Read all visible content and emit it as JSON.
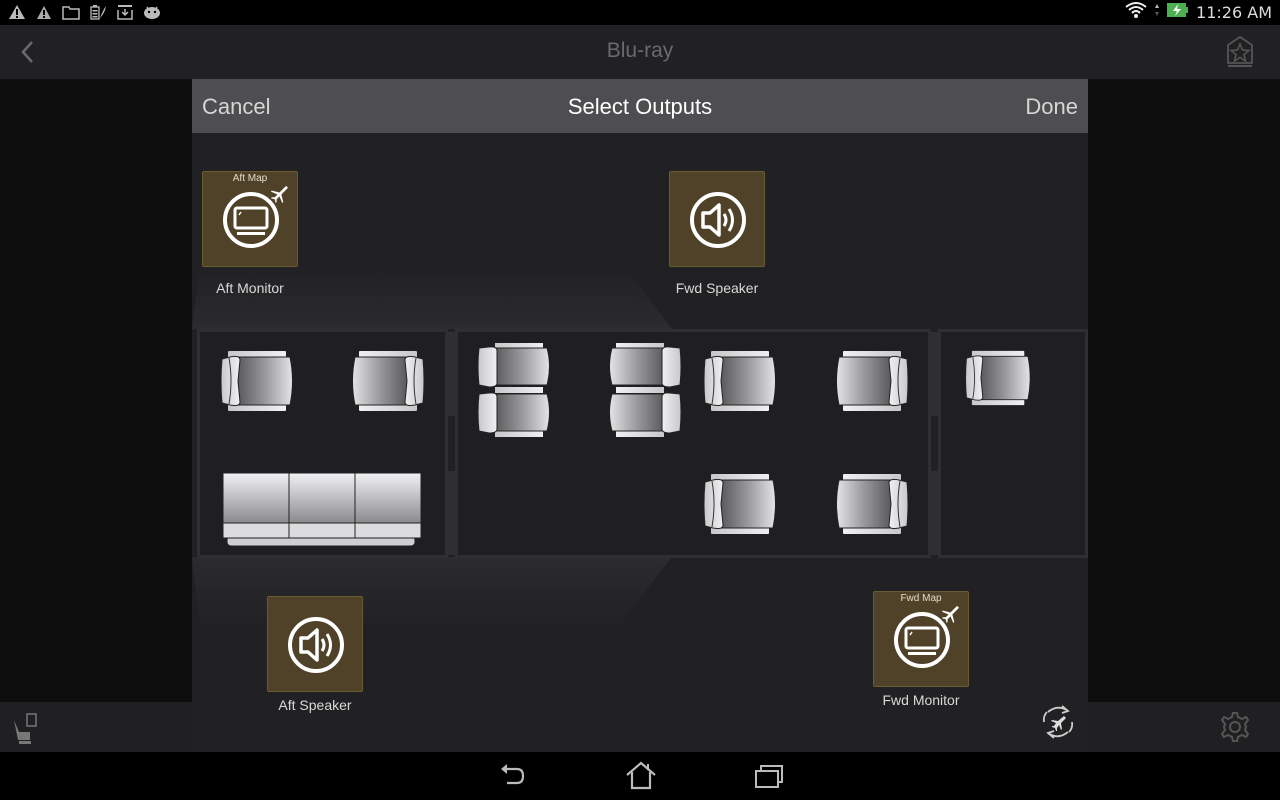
{
  "status_bar": {
    "notification_icons": [
      "warning-icon",
      "warning-icon",
      "folder-icon",
      "battery-feather-icon",
      "download-tray-icon",
      "android-icon"
    ],
    "wifi_icon": "wifi-icon",
    "battery_icon": "battery-charging-icon",
    "battery_color": "#4caf50",
    "time": "11:26 AM"
  },
  "app_bar": {
    "back_icon": "chevron-left-icon",
    "title": "Blu-ray",
    "favorite_icon": "star-badge-icon"
  },
  "dialog": {
    "cancel_label": "Cancel",
    "title": "Select Outputs",
    "done_label": "Done",
    "outputs": [
      {
        "id": "aft-monitor",
        "label": "Aft Monitor",
        "sublabel": "Aft Map",
        "icon": "monitor-icon",
        "badge_icon": "airplane-icon"
      },
      {
        "id": "fwd-speaker",
        "label": "Fwd Speaker",
        "sublabel": "",
        "icon": "speaker-icon",
        "badge_icon": ""
      },
      {
        "id": "aft-speaker",
        "label": "Aft Speaker",
        "sublabel": "",
        "icon": "speaker-icon",
        "badge_icon": ""
      },
      {
        "id": "fwd-monitor",
        "label": "Fwd Monitor",
        "sublabel": "Fwd Map",
        "icon": "monitor-icon",
        "badge_icon": "airplane-icon"
      }
    ],
    "tile_color": "#4f4228",
    "cabin_zones": [
      {
        "name": "aft-zone",
        "seats": [
          "club-seat",
          "club-seat",
          "divan"
        ]
      },
      {
        "name": "mid-zone",
        "seats": [
          "double-seat",
          "double-seat",
          "club-seat",
          "club-seat",
          "club-seat",
          "club-seat"
        ]
      },
      {
        "name": "fwd-zone",
        "seats": [
          "club-seat"
        ]
      }
    ],
    "sync_icon": "sync-airplane-icon"
  },
  "bottom_bar": {
    "left_icon": "seat-device-icon",
    "right_icon": "gear-icon"
  },
  "nav_bar": {
    "buttons": [
      "back-nav-icon",
      "home-icon",
      "recent-apps-icon"
    ]
  }
}
